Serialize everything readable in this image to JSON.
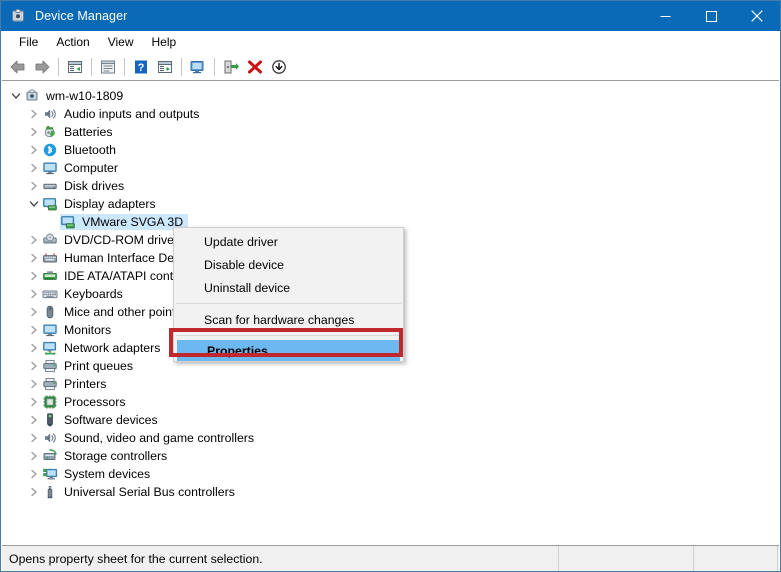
{
  "window": {
    "title": "Device Manager",
    "icon": "device-manager-icon",
    "controls": {
      "minimize": "minimize-icon",
      "maximize": "maximize-icon",
      "close": "close-icon"
    }
  },
  "menubar": {
    "items": [
      {
        "label": "File"
      },
      {
        "label": "Action"
      },
      {
        "label": "View"
      },
      {
        "label": "Help"
      }
    ]
  },
  "toolbar": {
    "buttons": [
      {
        "name": "back-icon"
      },
      {
        "name": "forward-icon"
      },
      {
        "name": "show-hide-console-tree-icon"
      },
      {
        "name": "properties-icon"
      },
      {
        "name": "help-icon"
      },
      {
        "name": "show-hide-action-pane-icon"
      },
      {
        "name": "scan-for-hardware-changes-icon"
      },
      {
        "name": "update-driver-icon"
      },
      {
        "name": "uninstall-device-icon"
      },
      {
        "name": "disable-device-icon"
      }
    ]
  },
  "tree": {
    "root": {
      "label": "wm-w10-1809",
      "icon": "computer-root-icon",
      "expanded": true
    },
    "items": [
      {
        "label": "Audio inputs and outputs",
        "icon": "speaker-icon",
        "expandable": true,
        "indent": 1
      },
      {
        "label": "Batteries",
        "icon": "battery-icon",
        "expandable": true,
        "indent": 1
      },
      {
        "label": "Bluetooth",
        "icon": "bluetooth-icon",
        "expandable": true,
        "indent": 1
      },
      {
        "label": "Computer",
        "icon": "monitor-icon",
        "expandable": true,
        "indent": 1
      },
      {
        "label": "Disk drives",
        "icon": "disk-drive-icon",
        "expandable": true,
        "indent": 1
      },
      {
        "label": "Display adapters",
        "icon": "display-adapter-icon",
        "expandable": true,
        "expanded": true,
        "indent": 1
      },
      {
        "label": "VMware SVGA 3D",
        "icon": "display-adapter-icon",
        "expandable": false,
        "indent": 2,
        "selected": true
      },
      {
        "label": "DVD/CD-ROM drives",
        "icon": "dvd-drive-icon",
        "expandable": true,
        "indent": 1
      },
      {
        "label": "Human Interface Devices",
        "icon": "hid-icon",
        "expandable": true,
        "indent": 1
      },
      {
        "label": "IDE ATA/ATAPI controllers",
        "icon": "ide-controller-icon",
        "expandable": true,
        "indent": 1
      },
      {
        "label": "Keyboards",
        "icon": "keyboard-icon",
        "expandable": true,
        "indent": 1
      },
      {
        "label": "Mice and other pointing devices",
        "icon": "mouse-icon",
        "expandable": true,
        "indent": 1
      },
      {
        "label": "Monitors",
        "icon": "monitor-icon",
        "expandable": true,
        "indent": 1
      },
      {
        "label": "Network adapters",
        "icon": "network-adapter-icon",
        "expandable": true,
        "indent": 1
      },
      {
        "label": "Print queues",
        "icon": "printer-icon",
        "expandable": true,
        "indent": 1
      },
      {
        "label": "Printers",
        "icon": "printer-icon",
        "expandable": true,
        "indent": 1
      },
      {
        "label": "Processors",
        "icon": "processor-icon",
        "expandable": true,
        "indent": 1
      },
      {
        "label": "Software devices",
        "icon": "software-device-icon",
        "expandable": true,
        "indent": 1
      },
      {
        "label": "Sound, video and game controllers",
        "icon": "speaker-icon",
        "expandable": true,
        "indent": 1
      },
      {
        "label": "Storage controllers",
        "icon": "storage-controller-icon",
        "expandable": true,
        "indent": 1
      },
      {
        "label": "System devices",
        "icon": "system-device-icon",
        "expandable": true,
        "indent": 1
      },
      {
        "label": "Universal Serial Bus controllers",
        "icon": "usb-controller-icon",
        "expandable": true,
        "indent": 1
      }
    ]
  },
  "context_menu": {
    "items": [
      {
        "label": "Update driver",
        "type": "item"
      },
      {
        "label": "Disable device",
        "type": "item"
      },
      {
        "label": "Uninstall device",
        "type": "item"
      },
      {
        "type": "separator"
      },
      {
        "label": "Scan for hardware changes",
        "type": "item"
      },
      {
        "type": "separator"
      },
      {
        "label": "Properties",
        "type": "item",
        "highlighted": true,
        "bold": true
      }
    ]
  },
  "annotation": {
    "highlight_box_color": "#c0282d",
    "target": "Properties"
  },
  "statusbar": {
    "message": "Opens property sheet for the current selection.",
    "panels": [
      "",
      "",
      ""
    ]
  },
  "colors": {
    "titlebar": "#0b6ab8",
    "selection": "#cce8ff",
    "menu_highlight": "#6cb8f0",
    "annotation_red": "#c0282d",
    "statusbar": "#f0f0f0",
    "context_menu_bg": "#f2f2f2"
  }
}
